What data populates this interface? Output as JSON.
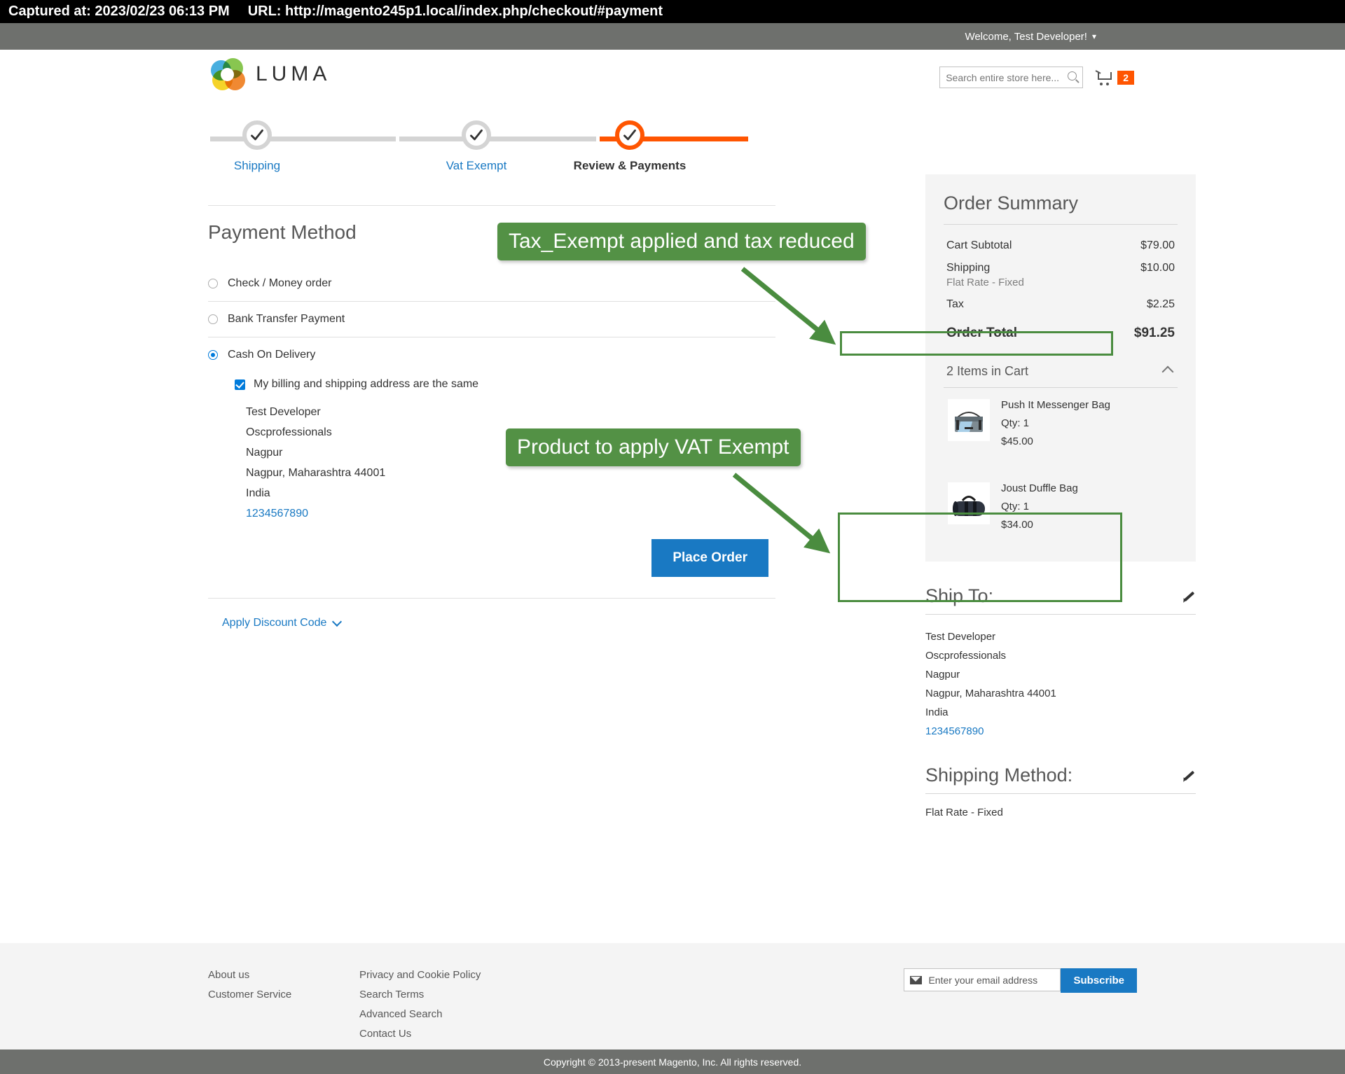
{
  "capture": {
    "captured_label": "Captured at: 2023/02/23 06:13 PM",
    "url_label": "URL: http://magento245p1.local/index.php/checkout/#payment"
  },
  "topbar": {
    "welcome": "Welcome, Test Developer!",
    "chevron": "chevron-down-icon"
  },
  "header": {
    "logo_text": "LUMA",
    "search": {
      "placeholder": "Search entire store here...",
      "value": ""
    },
    "cart_count": "2"
  },
  "progress": {
    "steps": [
      {
        "label": "Shipping",
        "state": "complete"
      },
      {
        "label": "Vat Exempt",
        "state": "complete"
      },
      {
        "label": "Review & Payments",
        "state": "active"
      }
    ]
  },
  "payment": {
    "title": "Payment Method",
    "methods": [
      {
        "label": "Check / Money order",
        "selected": false
      },
      {
        "label": "Bank Transfer Payment",
        "selected": false
      },
      {
        "label": "Cash On Delivery",
        "selected": true
      }
    ],
    "billing_same_label": "My billing and shipping address are the same",
    "billing_same_checked": true,
    "billing_address": [
      "Test Developer",
      "Oscprofessionals",
      "Nagpur",
      "Nagpur, Maharashtra 44001",
      "India"
    ],
    "billing_phone": "1234567890",
    "place_order_label": "Place Order",
    "discount_label": "Apply Discount Code"
  },
  "summary": {
    "title": "Order Summary",
    "rows": [
      {
        "label": "Cart Subtotal",
        "sub": "",
        "value": "$79.00"
      },
      {
        "label": "Shipping",
        "sub": "Flat Rate - Fixed",
        "value": "$10.00"
      },
      {
        "label": "Tax",
        "sub": "",
        "value": "$2.25"
      }
    ],
    "grand_label": "Order Total",
    "grand_value": "$91.25",
    "items_header": "2 Items in Cart",
    "items": [
      {
        "name": "Push It Messenger Bag",
        "qty": "Qty: 1",
        "price": "$45.00",
        "thumb": "messenger-bag-thumb"
      },
      {
        "name": "Joust Duffle Bag",
        "qty": "Qty: 1",
        "price": "$34.00",
        "thumb": "duffle-bag-thumb"
      }
    ],
    "ship_to_title": "Ship To:",
    "ship_to_address": [
      "Test Developer",
      "Oscprofessionals",
      "Nagpur",
      "Nagpur, Maharashtra 44001",
      "India"
    ],
    "ship_to_phone": "1234567890",
    "shipping_method_title": "Shipping Method:",
    "shipping_method_value": "Flat Rate - Fixed"
  },
  "footer": {
    "col1": [
      "About us",
      "Customer Service"
    ],
    "col2": [
      "Privacy and Cookie Policy",
      "Search Terms",
      "Advanced Search",
      "Contact Us"
    ],
    "newsletter_placeholder": "Enter your email address",
    "newsletter_value": "",
    "subscribe_label": "Subscribe",
    "copyright": "Copyright © 2013-present Magento, Inc. All rights reserved."
  },
  "annotations": [
    {
      "text": "Tax_Exempt applied and tax reduced"
    },
    {
      "text": "Product to apply VAT Exempt"
    }
  ],
  "colors": {
    "accent_orange": "#ff5501",
    "link_blue": "#1979c3",
    "button_blue": "#1979c3",
    "annotation_green": "#539145",
    "highlight_green": "#4a8c3f",
    "topbar_gray": "#6e706d"
  }
}
